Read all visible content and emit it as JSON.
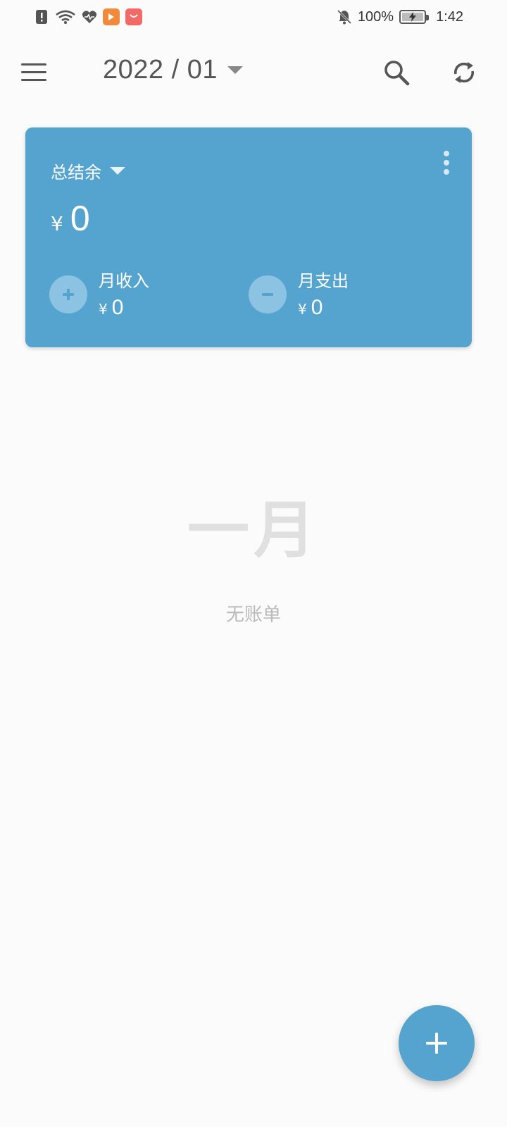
{
  "status_bar": {
    "battery_percent": "100%",
    "time": "1:42",
    "icons": [
      "alert-icon",
      "wifi-icon",
      "heart-icon",
      "app-icon-orange",
      "app-icon-red",
      "bell-off-icon",
      "battery-charging-icon"
    ]
  },
  "header": {
    "month": "2022 / 01",
    "icons": [
      "menu-icon",
      "chevron-down-icon",
      "search-icon",
      "sync-icon"
    ]
  },
  "card": {
    "title": "总结余",
    "currency": "¥",
    "balance": "0",
    "income": {
      "label": "月收入",
      "currency": "¥",
      "amount": "0"
    },
    "expense": {
      "label": "月支出",
      "currency": "¥",
      "amount": "0"
    },
    "colors": {
      "background": "#55a3cf",
      "icon_bg": "#8cc3e3"
    }
  },
  "empty_state": {
    "month_name": "一月",
    "message": "无账单"
  },
  "fab": {
    "icon": "plus-icon"
  }
}
